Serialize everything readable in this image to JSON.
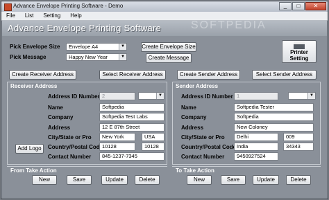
{
  "window": {
    "title": "Advance Envelope Printing Software - Demo",
    "min": "_",
    "max": "□",
    "close": "✕"
  },
  "menu": [
    "File",
    "List",
    "Setting",
    "Help"
  ],
  "banner": {
    "title": "Advance Envelope Printing Software",
    "watermark": "SOFTPEDIA"
  },
  "top": {
    "size_label": "Pick Envelope Size",
    "size_value": "Envelope A4",
    "message_label": "Pick Message",
    "message_value": "Happy New Year",
    "create_envelope_size": "Create Envelope Size",
    "create_message": "Create Message",
    "printer_setting_1": "Printer",
    "printer_setting_2": "Setting"
  },
  "actions": {
    "create_receiver": "Create Receiver Address",
    "select_receiver": "Select  Receiver Address",
    "create_sender": "Create Sender Address",
    "select_sender": "Select Sender Address"
  },
  "receiver": {
    "title": "Receiver Address",
    "id_label": "Address ID Number",
    "id_value": "2",
    "name_label": "Name",
    "name_value": "Softpedia",
    "company_label": "Company",
    "company_value": "Softpedia Test Labs",
    "address_label": "Address",
    "address_value": "12 E 87th Street",
    "city_label": "City/State or Pro",
    "city_value": "New York",
    "state_value": "USA",
    "postal_label": "Country/Postal Code",
    "country_value": "10128",
    "postal_value": "10128",
    "contact_label": "Contact Number",
    "contact_value": "845-1237-7345",
    "add_logo": "Add Logo"
  },
  "sender": {
    "title": "Sender Address",
    "id_label": "Address ID Number",
    "id_value": "1",
    "name_label": "Name",
    "name_value": "Softpedia Tester",
    "company_label": "Company",
    "company_value": "Softpedia",
    "address_label": "Address",
    "address_value": "New Coloney",
    "city_label": "City/State or Pro",
    "city_value": "Delhi",
    "state_value": "009",
    "postal_label": "Country/Postal Code",
    "country_value": "India",
    "postal_value": "34343",
    "contact_label": "Contact Number",
    "contact_value": "9450927524"
  },
  "from_actions": {
    "title": "From Take Action",
    "new": "New",
    "save": "Save",
    "update": "Update",
    "delete": "Delete"
  },
  "to_actions": {
    "title": "To Take Action",
    "new": "New",
    "save": "Save",
    "update": "Update",
    "delete": "Delete"
  }
}
